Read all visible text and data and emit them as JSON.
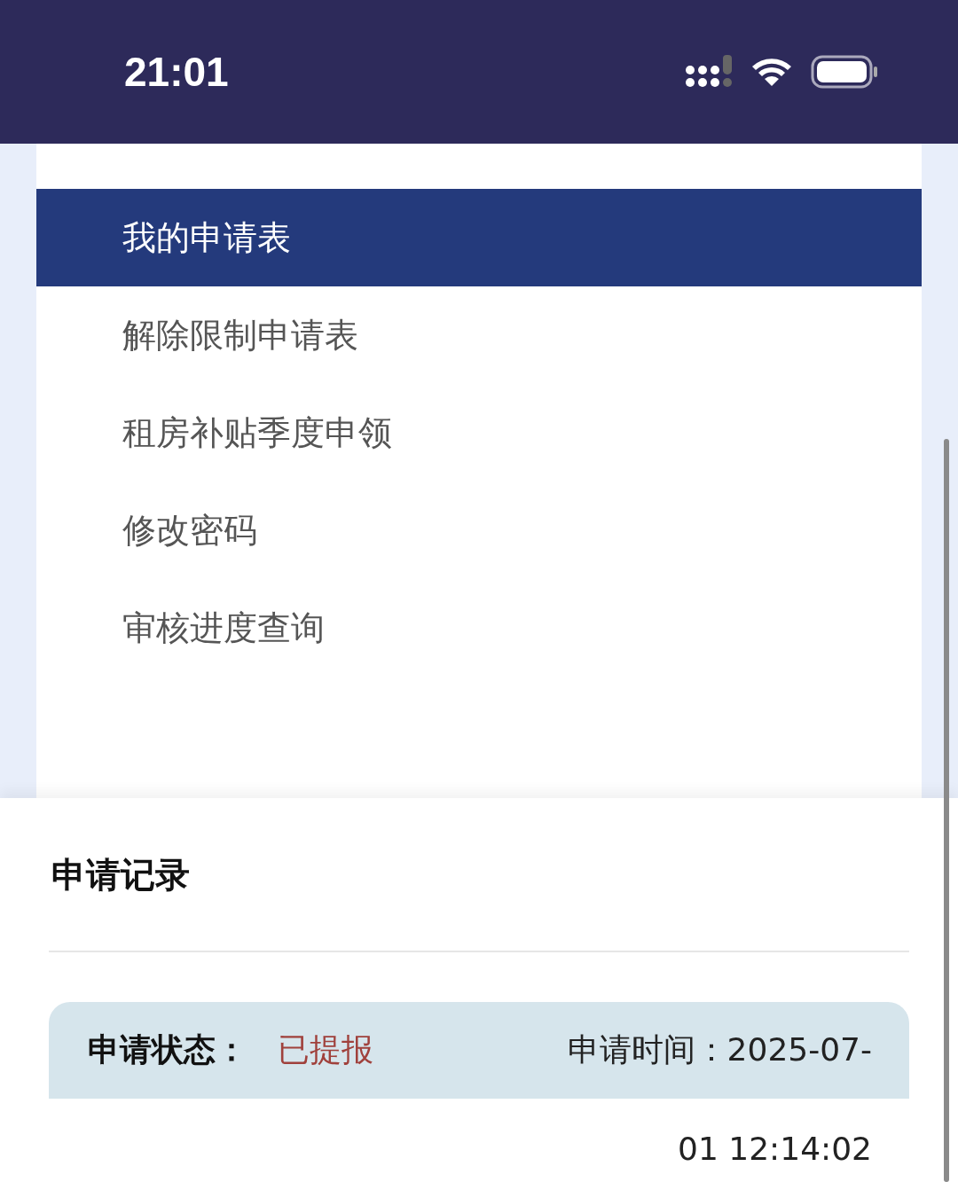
{
  "status_bar": {
    "time": "21:01"
  },
  "menu": {
    "items": [
      {
        "label": "我的申请表",
        "selected": true
      },
      {
        "label": "解除限制申请表",
        "selected": false
      },
      {
        "label": "租房补贴季度申领",
        "selected": false
      },
      {
        "label": "修改密码",
        "selected": false
      },
      {
        "label": "审核进度查询",
        "selected": false
      }
    ]
  },
  "records": {
    "title": "申请记录",
    "items": [
      {
        "status_label": "申请状态：",
        "status": "已提报",
        "time_label": "申请时间：",
        "time_line_1": "2025-07-",
        "time_line_2": "01 12:14:02"
      }
    ]
  }
}
